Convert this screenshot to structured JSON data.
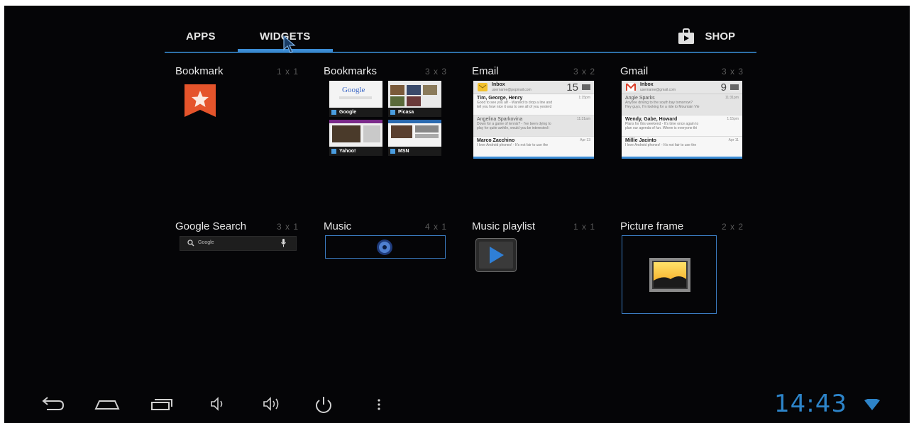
{
  "tabs": {
    "apps_label": "APPS",
    "widgets_label": "WIDGETS",
    "shop_label": "SHOP",
    "active": "WIDGETS"
  },
  "widgets": [
    {
      "title": "Bookmark",
      "size": "1 x 1",
      "icon": "bookmark-star-icon"
    },
    {
      "title": "Bookmarks",
      "size": "3 x 3",
      "thumbs": [
        "Google",
        "Picasa",
        "Yahoo!",
        "MSN"
      ]
    },
    {
      "title": "Email",
      "size": "3 x 2"
    },
    {
      "title": "Gmail",
      "size": "3 x 3"
    },
    {
      "title": "Google Search",
      "size": "3 x 1",
      "search_text": "Google"
    },
    {
      "title": "Music",
      "size": "4 x 1",
      "icon": "music-disc-icon"
    },
    {
      "title": "Music playlist",
      "size": "1 x 1",
      "icon": "play-icon"
    },
    {
      "title": "Picture frame",
      "size": "2 x 2",
      "icon": "picture-icon"
    }
  ],
  "email_preview": {
    "inbox": "Inbox",
    "account": "username@popmail.com",
    "count": "15",
    "messages": [
      {
        "from": "Tim, George, Henry",
        "time": "1:15pm",
        "snippet_a": "Good to see you all! - Wanted to drop a line and",
        "snippet_b": "tell you how nice it was to see all of you yesterd",
        "read": false
      },
      {
        "from": "Angelina Sparkovina",
        "time": "11:31am",
        "snippet_a": "Down for a game of tennis? - I've been dying to",
        "snippet_b": "play for quite awhile, would you be interested i",
        "read": true
      },
      {
        "from": "Marco Zacchino",
        "time": "Apr 13",
        "snippet_a": "I love Android phones! - It's not fair to use the",
        "snippet_b": "",
        "read": false
      }
    ]
  },
  "gmail_preview": {
    "inbox": "Inbox",
    "account": "username@gmail.com",
    "count": "9",
    "messages": [
      {
        "from": "Angie Sparks",
        "time": "11:31pm",
        "snippet_a": "Anyone driving to the south bay tomorrow?",
        "snippet_b": "Hey guys, I'm looking for a ride to Mountain Vie",
        "read": true
      },
      {
        "from": "Wendy, Gabe, Howard",
        "time": "1:15pm",
        "snippet_a": "Plans for this weekend - It's time once again to",
        "snippet_b": "plan our agenda of fun. Where is everyone thi",
        "read": false
      },
      {
        "from": "Millie Jacinto",
        "time": "Apr 11",
        "snippet_a": "I love Android phones! - It's not fair to use the",
        "snippet_b": "",
        "read": false
      }
    ]
  },
  "status": {
    "clock": "14:43",
    "accent": "#2d84c9"
  },
  "navbar": [
    "back-icon",
    "home-icon",
    "recent-apps-icon",
    "volume-down-icon",
    "volume-up-icon",
    "power-icon",
    "menu-icon"
  ]
}
